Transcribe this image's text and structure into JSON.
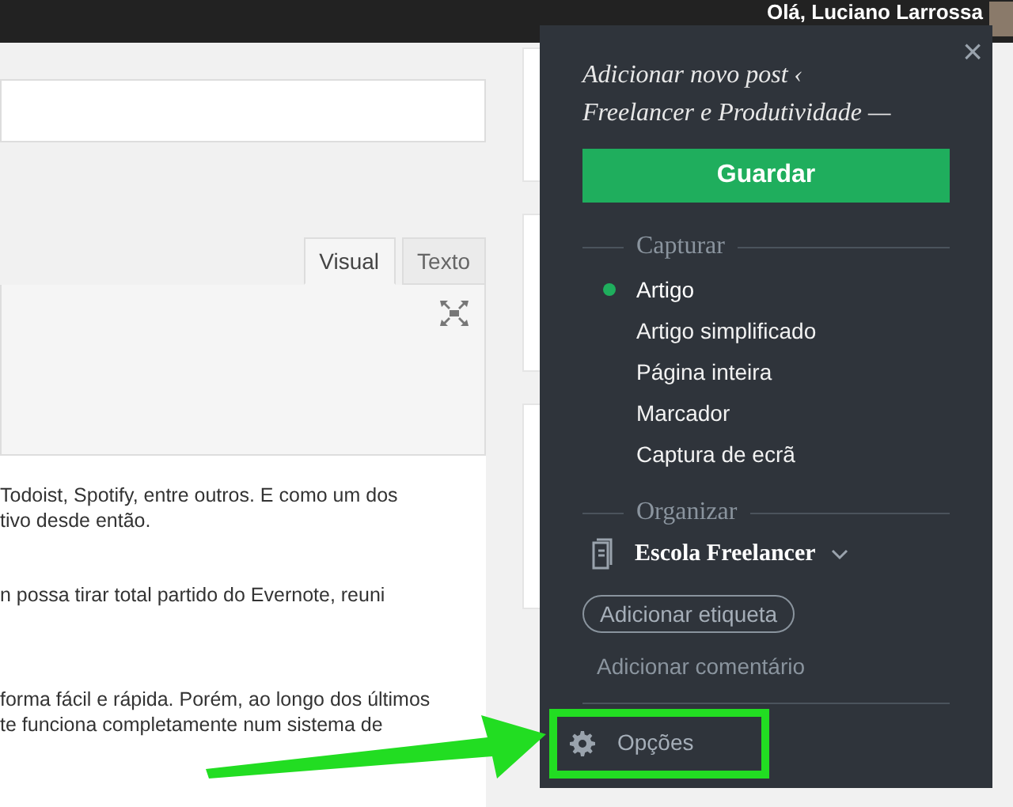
{
  "top_bar": {
    "greeting": "Olá, Luciano Larrossa"
  },
  "editor": {
    "tabs": [
      {
        "label": "Visual",
        "selected": true
      },
      {
        "label": "Texto",
        "selected": false
      }
    ],
    "lines": [
      {
        "text": "Todoist, Spotify, entre outros. E como um dos"
      },
      {
        "text": "tivo desde então."
      },
      {
        "text": "n possa tirar total partido do Evernote, reuni"
      },
      {
        "text": "forma fácil e rápida. Porém, ao longo dos últimos"
      },
      {
        "text": "te funciona completamente num sistema de"
      }
    ]
  },
  "clipper": {
    "title": "Adicionar novo post ‹ Freelancer e Produtividade —",
    "close": "×",
    "save_button": "Guardar",
    "capture": {
      "heading": "Capturar",
      "items": [
        {
          "label": "Artigo",
          "selected": true
        },
        {
          "label": "Artigo simplificado",
          "selected": false
        },
        {
          "label": "Página inteira",
          "selected": false
        },
        {
          "label": "Marcador",
          "selected": false
        },
        {
          "label": "Captura de ecrã",
          "selected": false
        }
      ]
    },
    "organize": {
      "heading": "Organizar",
      "notebook": "Escola Freelancer",
      "tag_button": "Adicionar etiqueta",
      "comment": "Adicionar comentário"
    },
    "options": {
      "label": "Opções",
      "highlighted": true
    }
  }
}
